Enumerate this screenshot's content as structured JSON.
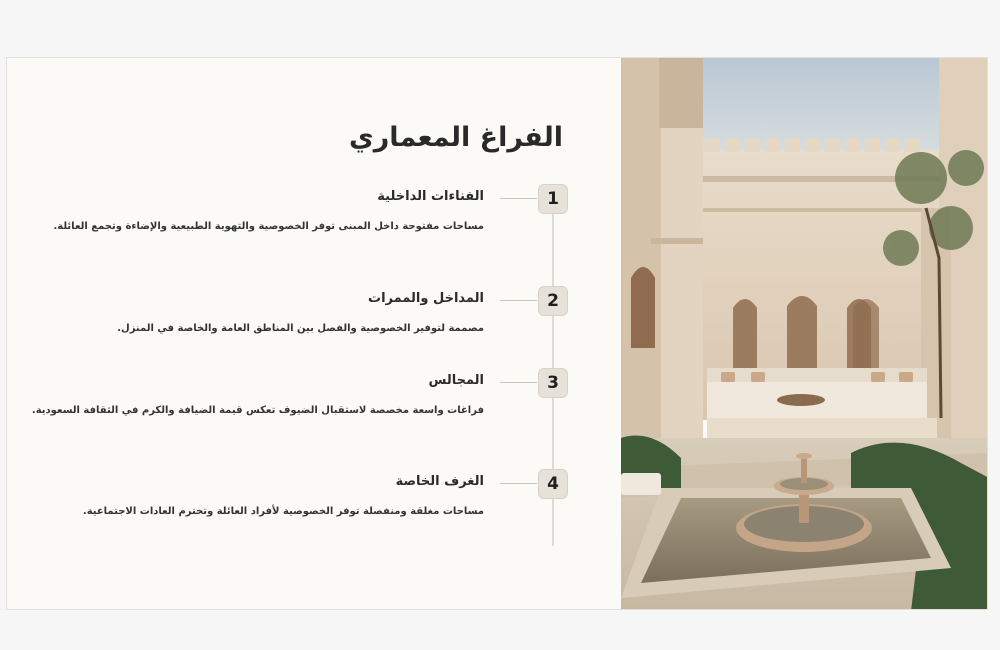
{
  "slide": {
    "title": "الفراغ المعماري",
    "items": [
      {
        "number": "1",
        "title": "الفناءات الداخلية",
        "description": "مساحات مفتوحة داخل المبنى توفر الخصوصية والتهوية الطبيعية والإضاءة وتجمع العائلة."
      },
      {
        "number": "2",
        "title": "المداخل والممرات",
        "description": "مصممة لتوفير الخصوصية والفصل بين المناطق العامة والخاصة في المنزل."
      },
      {
        "number": "3",
        "title": "المجالس",
        "description": "فراغات واسعة مخصصة لاستقبال الضيوف تعكس قيمة الضيافة والكرم في الثقافة السعودية."
      },
      {
        "number": "4",
        "title": "الغرف الخاصة",
        "description": "مساحات مغلقة ومنفصلة توفر الخصوصية لأفراد العائلة وتحترم العادات الاجتماعية."
      }
    ]
  },
  "colors": {
    "background": "#fbfaf6",
    "badge": "#e7e2d9",
    "timeline": "#dedbd4",
    "text": "#2a2a2a"
  }
}
